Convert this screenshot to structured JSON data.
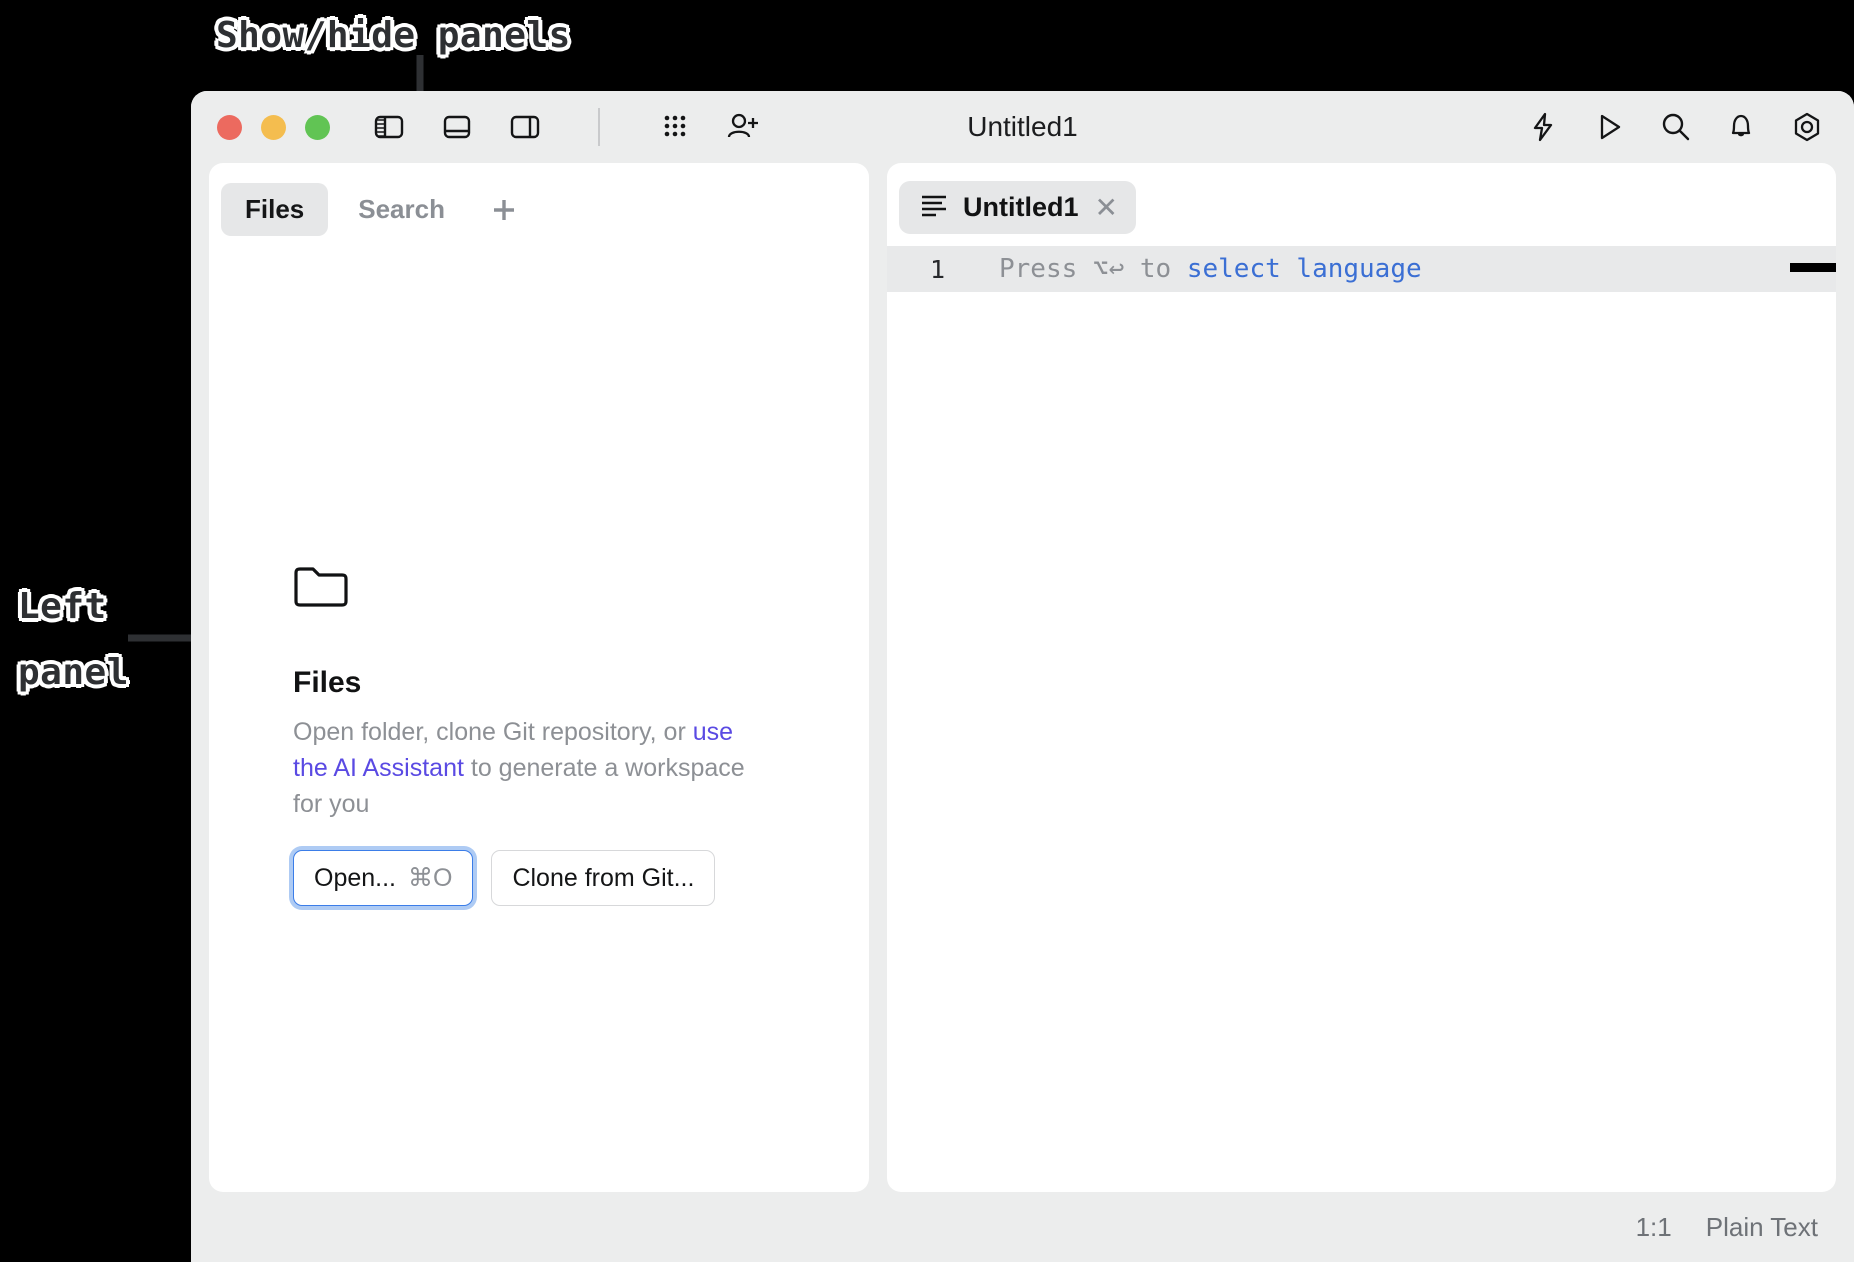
{
  "annotations": [
    {
      "id": "panels",
      "text": "Show/hide panels",
      "arrow": "down"
    },
    {
      "id": "left",
      "text": "Left\npanel",
      "arrow": "right"
    }
  ],
  "window": {
    "title": "Untitled1",
    "traffic_lights": [
      {
        "name": "close",
        "color": "#ec6a5f"
      },
      {
        "name": "minimize",
        "color": "#f4bd4f"
      },
      {
        "name": "maximize",
        "color": "#61c454"
      }
    ],
    "toolbar_left": [
      {
        "name": "toggle-left-panel-icon",
        "label": "Toggle left panel"
      },
      {
        "name": "toggle-bottom-panel-icon",
        "label": "Toggle bottom panel"
      },
      {
        "name": "toggle-right-panel-icon",
        "label": "Toggle right panel"
      },
      {
        "name": "apps-grid-icon",
        "label": "Apps"
      },
      {
        "name": "add-person-icon",
        "label": "Invite"
      }
    ],
    "toolbar_right": [
      {
        "name": "lightning-icon",
        "label": "Actions"
      },
      {
        "name": "run-icon",
        "label": "Run"
      },
      {
        "name": "search-icon",
        "label": "Search"
      },
      {
        "name": "bell-icon",
        "label": "Notifications"
      },
      {
        "name": "settings-hex-icon",
        "label": "Settings"
      }
    ]
  },
  "left_panel": {
    "tabs": [
      {
        "label": "Files",
        "active": true
      },
      {
        "label": "Search",
        "active": false
      }
    ],
    "add_tab_label": "+",
    "empty_state": {
      "icon": "folder-icon",
      "title": "Files",
      "desc_part1": "Open folder, clone Git repository, or ",
      "desc_link": "use the AI Assistant",
      "desc_part2": " to generate a workspace for you",
      "buttons": [
        {
          "label": "Open...",
          "shortcut": "⌘O",
          "focused": true
        },
        {
          "label": "Clone from Git...",
          "shortcut": "",
          "focused": false
        }
      ]
    }
  },
  "editor": {
    "tab": {
      "icon": "text-lines-icon",
      "label": "Untitled1",
      "close_label": "✕"
    },
    "line_number": "1",
    "hint_prefix": "Press ⌥↩ to ",
    "hint_link": "select language"
  },
  "statusbar": {
    "caret_position": "1:1",
    "language": "Plain Text"
  },
  "colors": {
    "accent_link": "#5a4ae3",
    "code_link": "#3b6fd4",
    "focus_ring": "#aecbf4",
    "window_chrome": "#eceded",
    "panel_bg": "#ffffff"
  }
}
